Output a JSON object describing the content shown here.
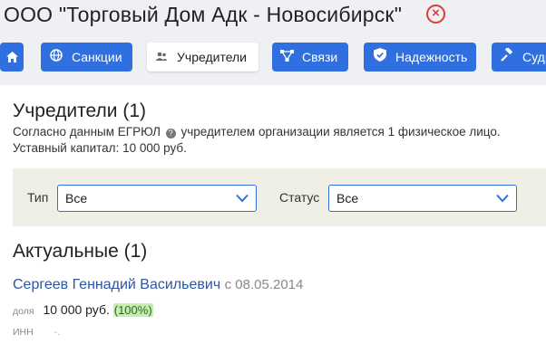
{
  "header": {
    "company_title": "ООО \"Торговый Дом Адк - Новосибирск\"",
    "close_symbol": "×"
  },
  "tabs": [
    {
      "label": "",
      "icon": "home-icon"
    },
    {
      "label": "Санкции",
      "icon": "globe-icon"
    },
    {
      "label": "Учредители",
      "icon": "people-icon",
      "active": true
    },
    {
      "label": "Связи",
      "icon": "network-icon"
    },
    {
      "label": "Надежность",
      "icon": "shield-check-icon"
    },
    {
      "label": "Суды",
      "icon": "gavel-icon"
    }
  ],
  "founders": {
    "title": "Учредители (1)",
    "desc_before": "Согласно данным ЕГРЮЛ",
    "desc_after": "учредителем организации является 1 физическое лицо.",
    "capital": "Уставный капитал: 10 000 руб."
  },
  "filters": {
    "type_label": "Тип",
    "type_value": "Все",
    "status_label": "Статус",
    "status_value": "Все"
  },
  "actual": {
    "title": "Актуальные (1)",
    "person": {
      "name": "Сергеев Геннадий Васильевич",
      "since": "с 08.05.2014",
      "share_label": "доля",
      "share_value": "10 000 руб.",
      "share_pct": "(100%)",
      "inn_label": "ИНН",
      "inn_value": "-."
    }
  },
  "colors": {
    "accent": "#2f6fe0",
    "danger": "#e53935",
    "link": "#2a56a8",
    "highlight": "#c7ecb4"
  }
}
